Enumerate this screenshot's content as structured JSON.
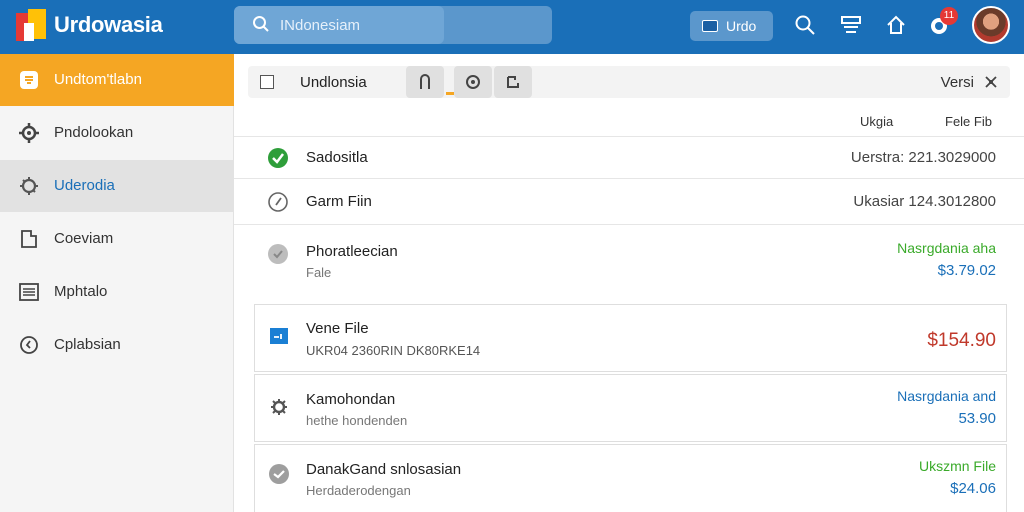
{
  "app": {
    "title": "Urdowasia"
  },
  "search": {
    "placeholder": "INdonesiam"
  },
  "header": {
    "button_label": "Urdo",
    "notification_count": "11"
  },
  "sidebar": {
    "items": [
      {
        "label": "Undtom'tlabn"
      },
      {
        "label": "Pndolookan"
      },
      {
        "label": "Uderodia"
      },
      {
        "label": "Coeviam"
      },
      {
        "label": "Mphtalo"
      },
      {
        "label": "Cplabsian"
      }
    ]
  },
  "toolbar": {
    "title": "Undlonsia",
    "right_label": "Versi"
  },
  "columns": {
    "col1": "Ukgia",
    "col2": "Fele Fib"
  },
  "rows": [
    {
      "title": "Sadositla",
      "value": "Uerstra: 221.3029000"
    },
    {
      "title": "Garm Fiin",
      "value": "Ukasiar 124.3012800"
    },
    {
      "title": "Phoratleecian",
      "subtitle": "Fale",
      "status": "Nasrgdania aha",
      "amount": "$3.79.02"
    },
    {
      "title": "Vene File",
      "subtitle": "UKR04 2360RIN DK80RKE14",
      "amount": "$154.90"
    },
    {
      "title": "Kamohondan",
      "subtitle": "hethe hondenden",
      "status": "Nasrgdania and",
      "amount": "53.90"
    },
    {
      "title": "DanakGand snlosasian",
      "subtitle": "Herdaderodengan",
      "status": "Ukszmn File",
      "amount": "$24.06"
    }
  ],
  "colors": {
    "topbar": "#1a6fb8",
    "accent": "#f5a623",
    "green": "#3aaa2a",
    "blue": "#1a6fb8",
    "red": "#c0392b"
  }
}
